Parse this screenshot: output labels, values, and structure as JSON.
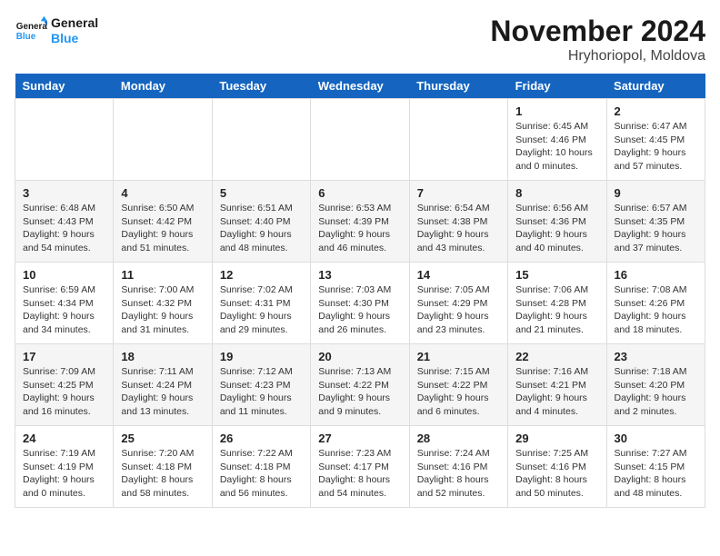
{
  "logo": {
    "general": "General",
    "blue": "Blue"
  },
  "title": "November 2024",
  "location": "Hryhoriopol, Moldova",
  "weekdays": [
    "Sunday",
    "Monday",
    "Tuesday",
    "Wednesday",
    "Thursday",
    "Friday",
    "Saturday"
  ],
  "weeks": [
    [
      {
        "day": "",
        "info": ""
      },
      {
        "day": "",
        "info": ""
      },
      {
        "day": "",
        "info": ""
      },
      {
        "day": "",
        "info": ""
      },
      {
        "day": "",
        "info": ""
      },
      {
        "day": "1",
        "info": "Sunrise: 6:45 AM\nSunset: 4:46 PM\nDaylight: 10 hours and 0 minutes."
      },
      {
        "day": "2",
        "info": "Sunrise: 6:47 AM\nSunset: 4:45 PM\nDaylight: 9 hours and 57 minutes."
      }
    ],
    [
      {
        "day": "3",
        "info": "Sunrise: 6:48 AM\nSunset: 4:43 PM\nDaylight: 9 hours and 54 minutes."
      },
      {
        "day": "4",
        "info": "Sunrise: 6:50 AM\nSunset: 4:42 PM\nDaylight: 9 hours and 51 minutes."
      },
      {
        "day": "5",
        "info": "Sunrise: 6:51 AM\nSunset: 4:40 PM\nDaylight: 9 hours and 48 minutes."
      },
      {
        "day": "6",
        "info": "Sunrise: 6:53 AM\nSunset: 4:39 PM\nDaylight: 9 hours and 46 minutes."
      },
      {
        "day": "7",
        "info": "Sunrise: 6:54 AM\nSunset: 4:38 PM\nDaylight: 9 hours and 43 minutes."
      },
      {
        "day": "8",
        "info": "Sunrise: 6:56 AM\nSunset: 4:36 PM\nDaylight: 9 hours and 40 minutes."
      },
      {
        "day": "9",
        "info": "Sunrise: 6:57 AM\nSunset: 4:35 PM\nDaylight: 9 hours and 37 minutes."
      }
    ],
    [
      {
        "day": "10",
        "info": "Sunrise: 6:59 AM\nSunset: 4:34 PM\nDaylight: 9 hours and 34 minutes."
      },
      {
        "day": "11",
        "info": "Sunrise: 7:00 AM\nSunset: 4:32 PM\nDaylight: 9 hours and 31 minutes."
      },
      {
        "day": "12",
        "info": "Sunrise: 7:02 AM\nSunset: 4:31 PM\nDaylight: 9 hours and 29 minutes."
      },
      {
        "day": "13",
        "info": "Sunrise: 7:03 AM\nSunset: 4:30 PM\nDaylight: 9 hours and 26 minutes."
      },
      {
        "day": "14",
        "info": "Sunrise: 7:05 AM\nSunset: 4:29 PM\nDaylight: 9 hours and 23 minutes."
      },
      {
        "day": "15",
        "info": "Sunrise: 7:06 AM\nSunset: 4:28 PM\nDaylight: 9 hours and 21 minutes."
      },
      {
        "day": "16",
        "info": "Sunrise: 7:08 AM\nSunset: 4:26 PM\nDaylight: 9 hours and 18 minutes."
      }
    ],
    [
      {
        "day": "17",
        "info": "Sunrise: 7:09 AM\nSunset: 4:25 PM\nDaylight: 9 hours and 16 minutes."
      },
      {
        "day": "18",
        "info": "Sunrise: 7:11 AM\nSunset: 4:24 PM\nDaylight: 9 hours and 13 minutes."
      },
      {
        "day": "19",
        "info": "Sunrise: 7:12 AM\nSunset: 4:23 PM\nDaylight: 9 hours and 11 minutes."
      },
      {
        "day": "20",
        "info": "Sunrise: 7:13 AM\nSunset: 4:22 PM\nDaylight: 9 hours and 9 minutes."
      },
      {
        "day": "21",
        "info": "Sunrise: 7:15 AM\nSunset: 4:22 PM\nDaylight: 9 hours and 6 minutes."
      },
      {
        "day": "22",
        "info": "Sunrise: 7:16 AM\nSunset: 4:21 PM\nDaylight: 9 hours and 4 minutes."
      },
      {
        "day": "23",
        "info": "Sunrise: 7:18 AM\nSunset: 4:20 PM\nDaylight: 9 hours and 2 minutes."
      }
    ],
    [
      {
        "day": "24",
        "info": "Sunrise: 7:19 AM\nSunset: 4:19 PM\nDaylight: 9 hours and 0 minutes."
      },
      {
        "day": "25",
        "info": "Sunrise: 7:20 AM\nSunset: 4:18 PM\nDaylight: 8 hours and 58 minutes."
      },
      {
        "day": "26",
        "info": "Sunrise: 7:22 AM\nSunset: 4:18 PM\nDaylight: 8 hours and 56 minutes."
      },
      {
        "day": "27",
        "info": "Sunrise: 7:23 AM\nSunset: 4:17 PM\nDaylight: 8 hours and 54 minutes."
      },
      {
        "day": "28",
        "info": "Sunrise: 7:24 AM\nSunset: 4:16 PM\nDaylight: 8 hours and 52 minutes."
      },
      {
        "day": "29",
        "info": "Sunrise: 7:25 AM\nSunset: 4:16 PM\nDaylight: 8 hours and 50 minutes."
      },
      {
        "day": "30",
        "info": "Sunrise: 7:27 AM\nSunset: 4:15 PM\nDaylight: 8 hours and 48 minutes."
      }
    ]
  ]
}
